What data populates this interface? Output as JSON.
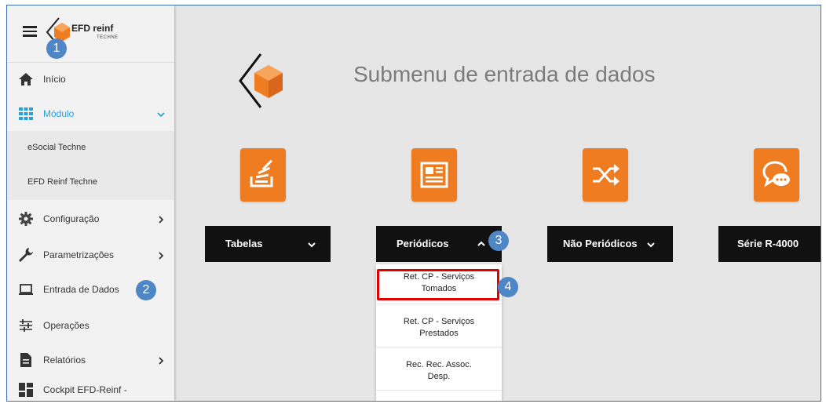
{
  "app": {
    "logo_text": "EFD reinf",
    "logo_subtext": "TECHNE"
  },
  "callouts": [
    "1",
    "2",
    "3",
    "4"
  ],
  "sidebar": {
    "items": [
      {
        "label": "Início",
        "icon": "home-icon"
      },
      {
        "label": "Módulo",
        "icon": "grid-icon",
        "active": true
      },
      {
        "label": "Configuração",
        "icon": "gear-icon"
      },
      {
        "label": "Parametrizações",
        "icon": "wrench-icon"
      },
      {
        "label": "Entrada de Dados",
        "icon": "laptop-icon"
      },
      {
        "label": "Operações",
        "icon": "sliders-icon"
      },
      {
        "label": "Relatórios",
        "icon": "document-icon"
      },
      {
        "label": "Cockpit EFD-Reinf -",
        "icon": "dashboard-icon"
      }
    ],
    "subitems": [
      "eSocial Techne",
      "EFD Reinf Techne"
    ]
  },
  "main": {
    "title": "Submenu de entrada de dados",
    "sections": [
      {
        "label": "Tabelas",
        "icon": "stack-icon"
      },
      {
        "label": "Periódicos",
        "icon": "newspaper-icon"
      },
      {
        "label": "Não Periódicos",
        "icon": "shuffle-icon"
      },
      {
        "label": "Série R-4000",
        "icon": "chat-icon"
      }
    ],
    "dropdown": [
      {
        "line1": "Ret. CP - Serviços",
        "line2": "Tomados"
      },
      {
        "line1": "Ret. CP - Serviços",
        "line2": "Prestados"
      },
      {
        "line1": "Rec. Rec. Assoc.",
        "line2": "Desp."
      }
    ]
  },
  "colors": {
    "accent_orange": "#f07c22",
    "active_blue": "#2a9fd8",
    "callout_blue": "#4f86c6",
    "highlight_red": "#e00000",
    "bar_black": "#111111"
  }
}
